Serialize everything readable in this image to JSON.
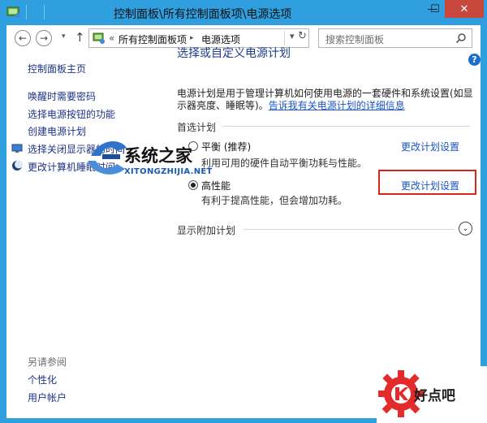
{
  "window": {
    "title": "控制面板\\所有控制面板项\\电源选项",
    "minimize_glyph": "—",
    "maximize_glyph": "☐",
    "close_glyph": "✕"
  },
  "navbar": {
    "back_glyph": "←",
    "forward_glyph": "→",
    "dropdown_glyph": "▾",
    "up_glyph": "↑",
    "breadcrumb_prefix": "«",
    "breadcrumb_parent": "所有控制面板项",
    "breadcrumb_sep": "▸",
    "breadcrumb_current": "电源选项",
    "addr_dropdown_glyph": "▾",
    "refresh_glyph": "↻",
    "search_placeholder": "搜索控制面板"
  },
  "sidebar": {
    "items": [
      {
        "label": "控制面板主页",
        "icon": ""
      },
      {
        "label": "唤醒时需要密码",
        "icon": ""
      },
      {
        "label": "选择电源按钮的功能",
        "icon": ""
      },
      {
        "label": "创建电源计划",
        "icon": ""
      },
      {
        "label": "选择关闭显示器的时间",
        "icon": "monitor-icon"
      },
      {
        "label": "更改计算机睡眠时间",
        "icon": "moon-icon"
      }
    ],
    "see_also_label": "另请参阅",
    "see_also_items": [
      {
        "label": "个性化"
      },
      {
        "label": "用户帐户"
      }
    ]
  },
  "main": {
    "title": "选择或自定义电源计划",
    "help_glyph": "?",
    "description": "电源计划是用于管理计算机如何使用电源的一套硬件和系统设置(如显示器亮度、睡眠等)。",
    "description_link": "告诉我有关电源计划的详细信息",
    "preferred_label": "首选计划",
    "plans": [
      {
        "name": "平衡 (推荐)",
        "desc": "利用可用的硬件自动平衡功耗与性能。",
        "change": "更改计划设置",
        "selected": false
      },
      {
        "name": "高性能",
        "desc": "有利于提高性能，但会增加功耗。",
        "change": "更改计划设置",
        "selected": true
      }
    ],
    "additional_label": "显示附加计划",
    "expand_glyph": "⌄"
  },
  "watermark": {
    "text": "系统之家",
    "subtext": "XITONGZHIJIA.NET"
  },
  "logo": {
    "text": "好点吧"
  },
  "colors": {
    "titlebar": "#2f9fe0",
    "link": "#1a56c4",
    "nav_link": "#1e3287",
    "highlight_border": "#d8261f",
    "logo_red": "#e32b2b"
  }
}
